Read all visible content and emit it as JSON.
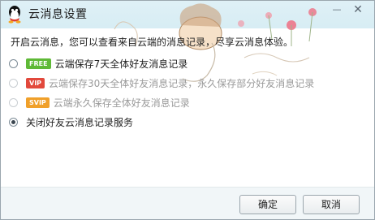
{
  "window": {
    "title": "云消息设置",
    "minimize": "—",
    "close": "✕"
  },
  "description": "开启云消息，您可以查看来自云端的消息记录，尽享云消息体验。",
  "options": [
    {
      "badge": "FREE",
      "badge_color": "#5fb937",
      "label": "云端保存7天全体好友消息记录",
      "checked": false,
      "disabled": false
    },
    {
      "badge": "VIP",
      "badge_color": "#e2493c",
      "label": "云端保存30天全体好友消息记录，永久保存部分好友消息记录",
      "checked": false,
      "disabled": true
    },
    {
      "badge": "SVIP",
      "badge_color": "#f0a02a",
      "label": "云端永久保存全体好友消息记录",
      "checked": false,
      "disabled": true
    },
    {
      "badge": "",
      "label": "关闭好友云消息记录服务",
      "checked": true,
      "disabled": false
    }
  ],
  "buttons": {
    "ok": "确定",
    "cancel": "取消"
  }
}
